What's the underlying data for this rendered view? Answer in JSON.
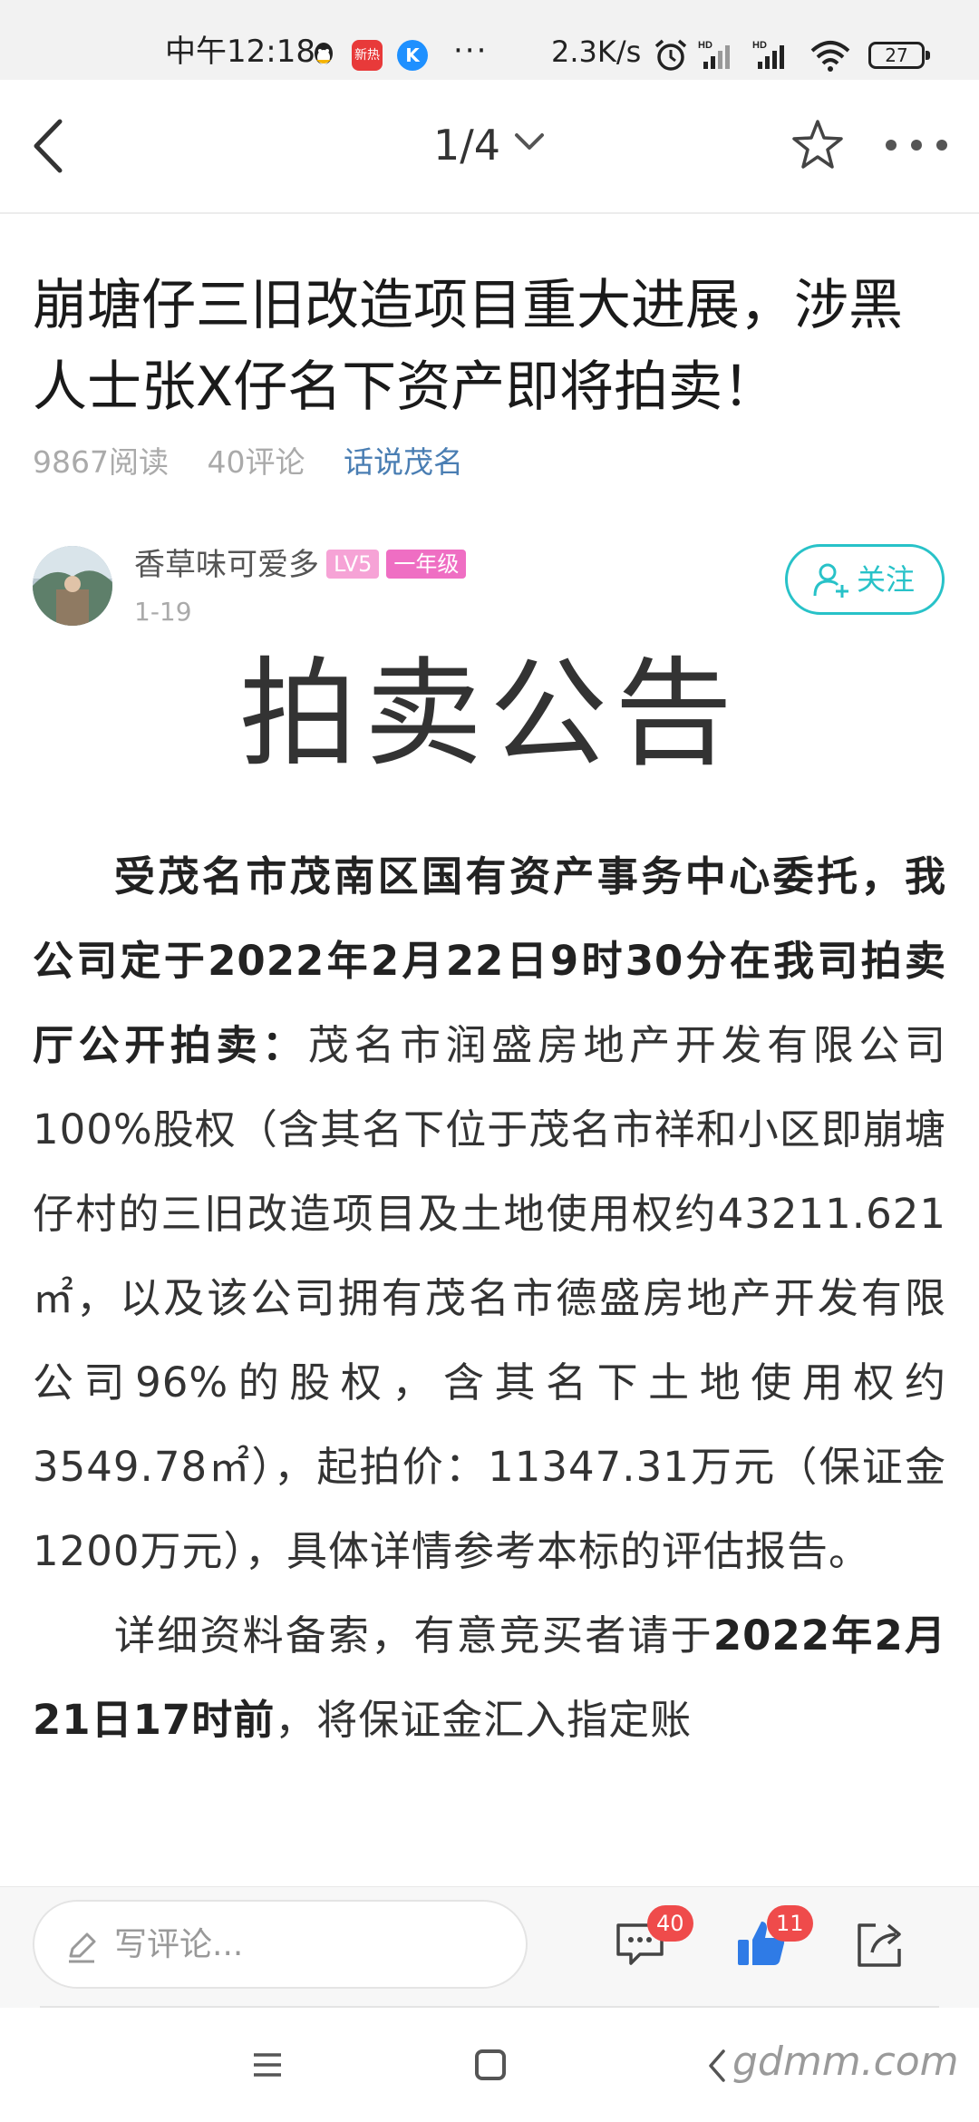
{
  "status_bar": {
    "time": "中午12:18",
    "apps": [
      {
        "name": "qq-icon",
        "color": "#1aa7ec"
      },
      {
        "name": "news-app-icon",
        "label": "新热",
        "color": "#e83a3a"
      },
      {
        "name": "k-app-icon",
        "label": "K",
        "color": "#1e90ff"
      }
    ],
    "more": "···",
    "net_speed": "2.3K/s",
    "battery": "27"
  },
  "nav": {
    "page_indicator": "1/4"
  },
  "article": {
    "title": "崩塘仔三旧改造项目重大进展，涉黑人士张X仔名下资产即将拍卖！",
    "reads": "9867阅读",
    "comments": "40评论",
    "forum": "话说茂名"
  },
  "author": {
    "name": "香草味可爱多",
    "level": "LV5",
    "grade": "一年级",
    "date": "1-19",
    "follow_label": "关注"
  },
  "content": {
    "heading": "拍卖公告",
    "p1_bold": "受茂名市茂南区国有资产事务中心委托，我公司定于2022年2月22日9时30分在我司拍卖厅公开拍卖：",
    "p1_rest": "茂名市润盛房地产开发有限公司100%股权（含其名下位于茂名市祥和小区即崩塘仔村的三旧改造项目及土地使用权约43211.621㎡，以及该公司拥有茂名市德盛房地产开发有限公司96%的股权，含其名下土地使用权约3549.78㎡），起拍价：11347.31万元（保证金1200万元），具体详情参考本标的评估报告。",
    "p2_start": "详细资料备索，有意竞买者请于",
    "p2_bold": "2022年2月21日17时前",
    "p2_rest": "，将保证金汇入指定账"
  },
  "comment_bar": {
    "placeholder": "写评论...",
    "comment_count": "40",
    "like_count": "11"
  },
  "watermark": "gdmm.com"
}
